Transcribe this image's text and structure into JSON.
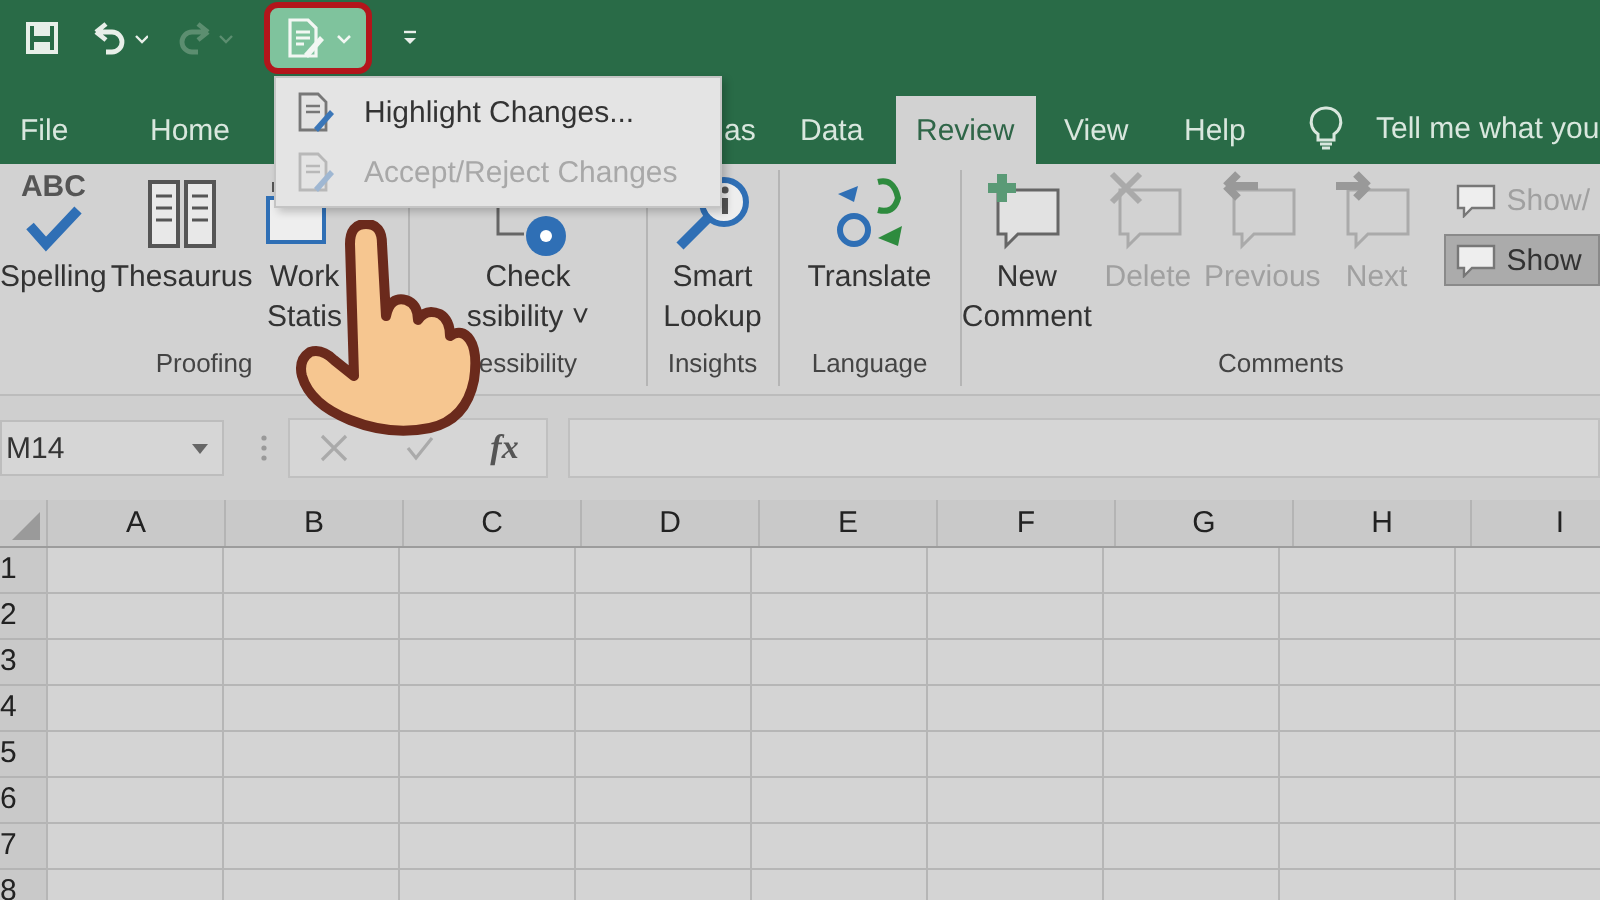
{
  "menu": {
    "items": [
      {
        "label": "Highlight Changes...",
        "disabled": false
      },
      {
        "label": "Accept/Reject Changes",
        "disabled": true
      }
    ]
  },
  "tabs": [
    {
      "label": "File",
      "selected": false
    },
    {
      "label": "Home",
      "selected": false
    },
    {
      "label": "as",
      "selected": false
    },
    {
      "label": "Data",
      "selected": false
    },
    {
      "label": "Review",
      "selected": true
    },
    {
      "label": "View",
      "selected": false
    },
    {
      "label": "Help",
      "selected": false
    }
  ],
  "tell_me": "Tell me what you",
  "ribbon": {
    "groups": [
      {
        "label": "Proofing",
        "buttons": [
          {
            "lines": [
              "Spelling"
            ],
            "icon_text": "ABC",
            "disabled": false
          },
          {
            "lines": [
              "Thesaurus"
            ],
            "disabled": false
          },
          {
            "lines": [
              "Work",
              "Statis"
            ],
            "disabled": false
          }
        ]
      },
      {
        "label": "essibility",
        "buttons": [
          {
            "lines": [
              "Check",
              "ssibility ˅"
            ],
            "disabled": false
          }
        ]
      },
      {
        "label": "Insights",
        "buttons": [
          {
            "lines": [
              "Smart",
              "Lookup"
            ],
            "disabled": false
          }
        ]
      },
      {
        "label": "Language",
        "buttons": [
          {
            "lines": [
              "Translate"
            ],
            "disabled": false
          }
        ]
      },
      {
        "label": "Comments",
        "buttons": [
          {
            "lines": [
              "New",
              "Comment"
            ],
            "disabled": false
          },
          {
            "lines": [
              "Delete"
            ],
            "disabled": true
          },
          {
            "lines": [
              "Previous"
            ],
            "disabled": true
          },
          {
            "lines": [
              "Next"
            ],
            "disabled": true
          }
        ],
        "small_buttons": [
          {
            "label": "Show/",
            "disabled": true,
            "selected": false
          },
          {
            "label": "Show",
            "disabled": false,
            "selected": true
          }
        ]
      }
    ]
  },
  "name_box": "M14",
  "fx": "fx",
  "sheet": {
    "columns": [
      "A",
      "B",
      "C",
      "D",
      "E",
      "F",
      "G",
      "H",
      "I"
    ],
    "rows": [
      "1",
      "2",
      "3",
      "4",
      "5",
      "6",
      "7",
      "8"
    ]
  }
}
